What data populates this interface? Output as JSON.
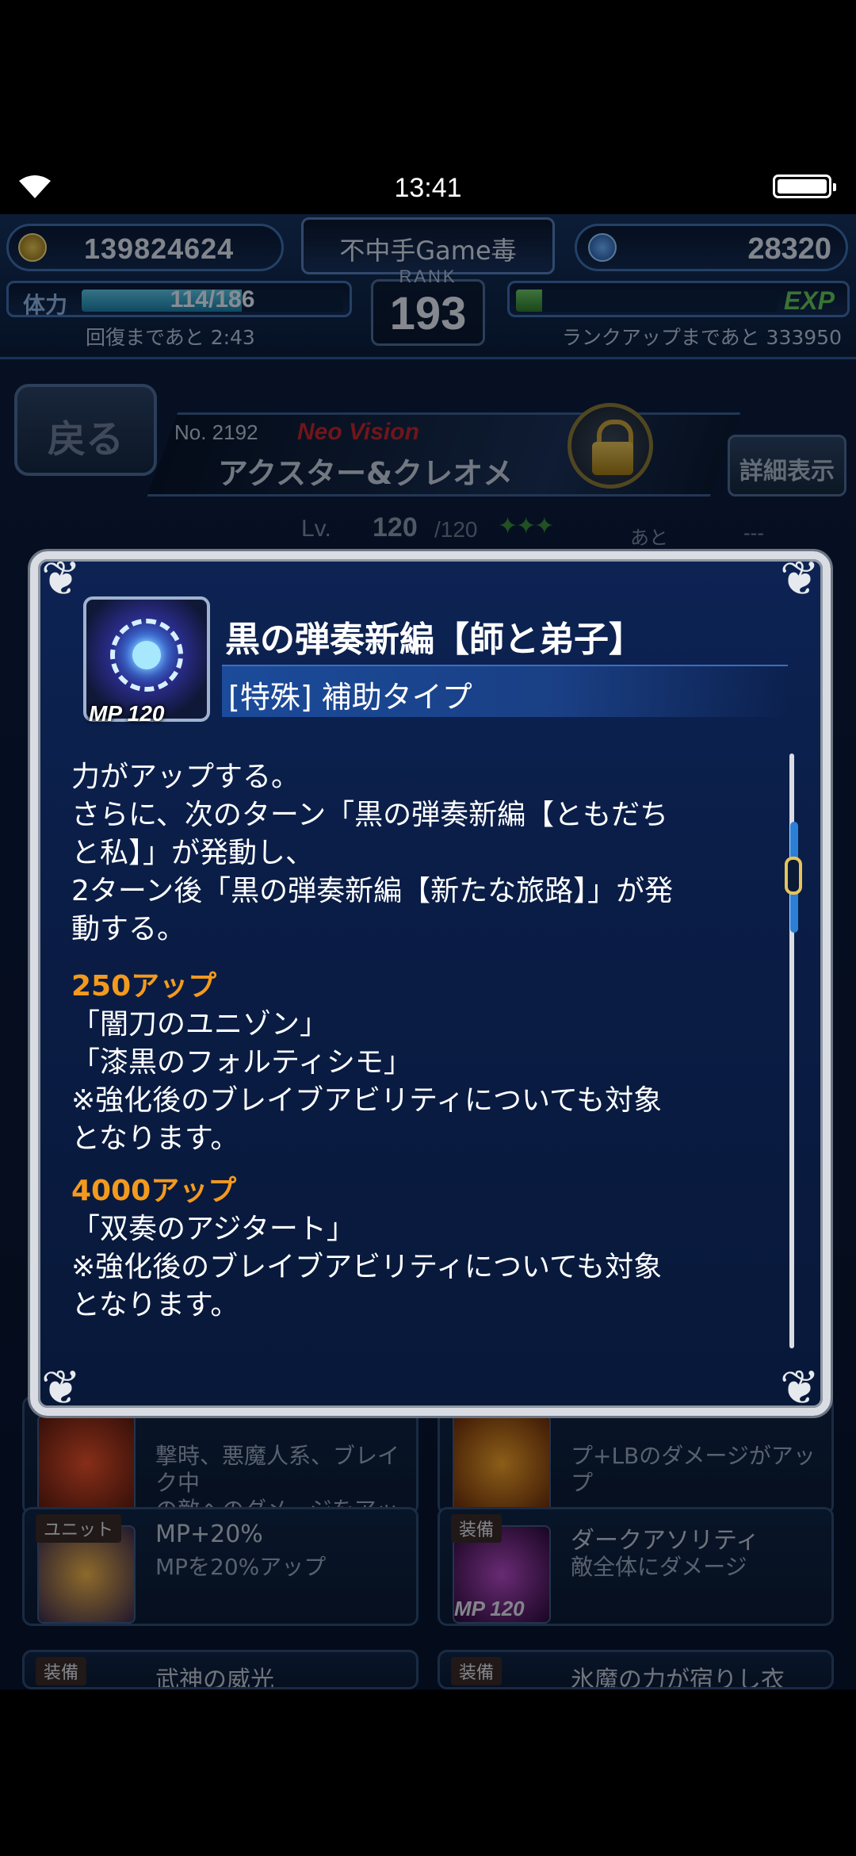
{
  "status_bar": {
    "time": "13:41"
  },
  "hud": {
    "gil": "139824624",
    "player_name": "不中手Game毒",
    "lapis": "28320",
    "rank_label": "RANK",
    "rank_value": "193",
    "hp_label": "体力",
    "hp_text": "114/186",
    "hp_fraction": 0.613,
    "recovery_text": "回復まであと 2:43",
    "exp_label": "EXP",
    "exp_fraction": 0.1,
    "rankup_text": "ランクアップまであと 333950"
  },
  "header": {
    "back_label": "戻る",
    "unit_no": "No. 2192",
    "unit_tier": "Neo Vision",
    "unit_name": "アクスター&クレオメ",
    "detail_label": "詳細表示",
    "level_label": "Lv.",
    "level_value": "120",
    "level_max": "/120",
    "stars": "✦✦✦",
    "remain_label": "あと",
    "remain_value": "---"
  },
  "modal": {
    "skill_name": "黒の弾奏新編【師と弟子】",
    "skill_type": "[特殊] 補助タイプ",
    "skill_mp": "MP 120",
    "description_lines": [
      {
        "text": "力がアップする。",
        "accent": false
      },
      {
        "text": "さらに、次のターン「黒の弾奏新編【ともだち",
        "accent": false
      },
      {
        "text": "と私】」が発動し、",
        "accent": false
      },
      {
        "text": "2ターン後「黒の弾奏新編【新たな旅路】」が発",
        "accent": false
      },
      {
        "text": "動する。",
        "accent": false
      },
      {
        "text": "250アップ",
        "accent": true
      },
      {
        "text": "「闇刀のユニゾン」",
        "accent": false
      },
      {
        "text": "「漆黒のフォルティシモ」",
        "accent": false
      },
      {
        "text": "※強化後のブレイブアビリティについても対象",
        "accent": false
      },
      {
        "text": "となります。",
        "accent": false
      },
      {
        "text": "4000アップ",
        "accent": true
      },
      {
        "text": "「双奏のアジタート」",
        "accent": false
      },
      {
        "text": "※強化後のブレイブアビリティについても対象",
        "accent": false
      },
      {
        "text": "となります。",
        "accent": false
      }
    ]
  },
  "cards": [
    {
      "title": "",
      "desc": [
        "撃時、悪魔人系、ブレイク中",
        "の敵へのダメージをアップ"
      ],
      "tag": "",
      "mp": ""
    },
    {
      "title": "",
      "desc": [
        "プ+LBのダメージがアップ"
      ],
      "tag": "",
      "mp": ""
    },
    {
      "title": "MP+20%",
      "desc": [
        "MPを20%アップ"
      ],
      "tag": "ユニット",
      "mp": ""
    },
    {
      "title": "ダークアソリティ",
      "desc": [
        "敵全体にダメージ"
      ],
      "tag": "装備",
      "mp": "MP 120"
    },
    {
      "title": "武神の威光",
      "desc": [],
      "tag": "装備",
      "mp": ""
    },
    {
      "title": "氷魔の力が宿りし衣",
      "desc": [],
      "tag": "装備",
      "mp": ""
    }
  ],
  "colors": {
    "accent": "#f39a1e",
    "modal_border": "#d9dde3",
    "modal_bg": "#0a1d46"
  }
}
